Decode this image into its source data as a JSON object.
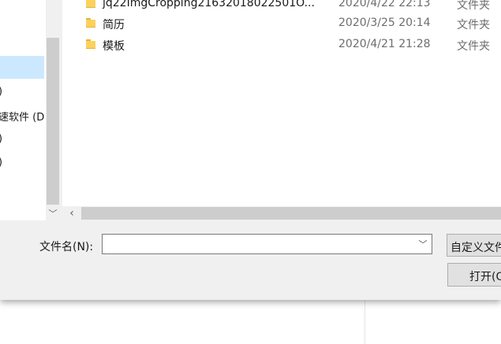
{
  "nav": {
    "items": [
      {
        "label": ")"
      },
      {
        "label": "速软件 (D"
      },
      {
        "label": ")"
      },
      {
        "label": ")"
      }
    ],
    "scroll_down": "﹀"
  },
  "files": [
    {
      "name": "jq22ImgCropping21632018022501O...",
      "date": "2020/4/22 22:13",
      "type": "文件夹"
    },
    {
      "name": "简历",
      "date": "2020/3/25 20:14",
      "type": "文件夹"
    },
    {
      "name": "模板",
      "date": "2020/4/21 21:28",
      "type": "文件夹"
    }
  ],
  "hscroll": {
    "left_arrow": "‹"
  },
  "filename": {
    "label": "文件名(N):",
    "value": "",
    "dropdown_arrow": "﹀"
  },
  "buttons": {
    "filter": "自定义文件",
    "open": "打开(O)"
  }
}
